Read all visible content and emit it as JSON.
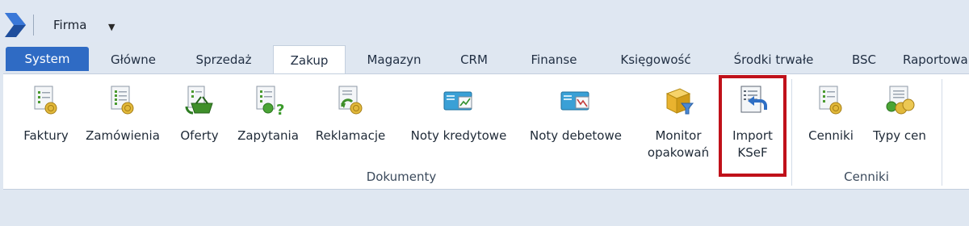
{
  "qat": {
    "logo_icon": "app-logo-icon",
    "firma_label": "Firma",
    "dropdown_icon": "triangle-down-icon"
  },
  "tabs": [
    "System",
    "Główne",
    "Sprzedaż",
    "Zakup",
    "Magazyn",
    "CRM",
    "Finanse",
    "Księgowość",
    "Środki trwałe",
    "BSC",
    "Raportowanie"
  ],
  "active_tab": "Zakup",
  "ribbon": {
    "groups": [
      {
        "label": "Dokumenty",
        "buttons": [
          {
            "label": "Faktury",
            "icon": "invoice-coin-icon"
          },
          {
            "label": "Zamówienia",
            "icon": "order-coin-icon"
          },
          {
            "label": "Oferty",
            "icon": "offer-basket-icon"
          },
          {
            "label": "Zapytania",
            "icon": "inquiry-question-icon"
          },
          {
            "label": "Reklamacje",
            "icon": "complaint-return-icon"
          },
          {
            "label": "Noty kredytowe",
            "icon": "credit-note-icon"
          },
          {
            "label": "Noty debetowe",
            "icon": "debit-note-icon"
          },
          {
            "label": "Monitor opakowań",
            "line1": "Monitor",
            "line2": "opakowań",
            "icon": "package-filter-icon"
          },
          {
            "label": "Import KSeF",
            "line1": "Import",
            "line2": "KSeF",
            "icon": "import-document-icon"
          }
        ]
      },
      {
        "label": "Cenniki",
        "buttons": [
          {
            "label": "Cenniki",
            "icon": "price-list-icon"
          },
          {
            "label": "Typy cen",
            "icon": "price-types-icon"
          }
        ]
      }
    ]
  },
  "colors": {
    "system_tab": "#2f6bc4",
    "highlight": "#c0111a",
    "background": "#dfe7f1"
  }
}
